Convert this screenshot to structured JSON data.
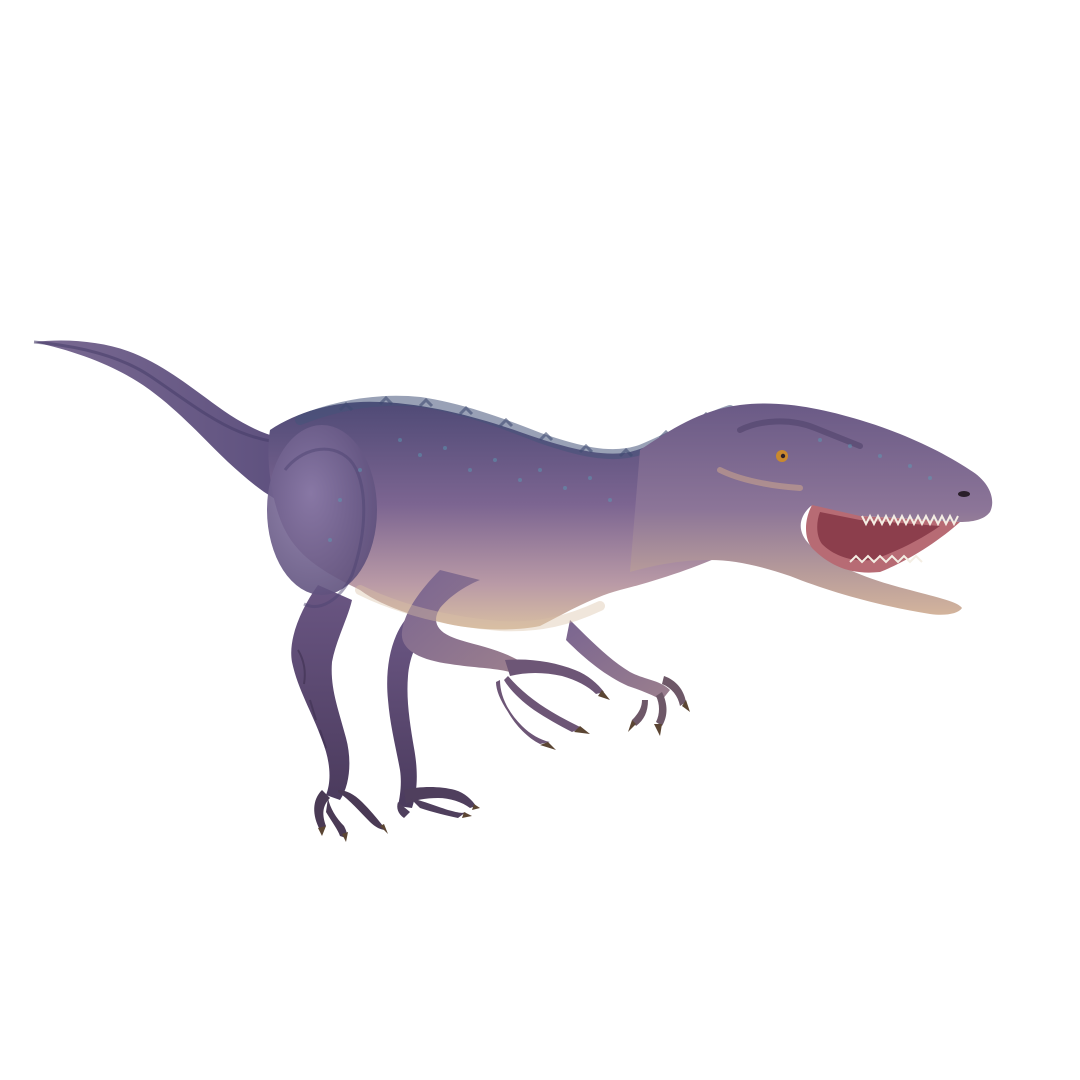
{
  "image": {
    "subject_icon": "dinosaur-illustration",
    "colors": {
      "background": "#ffffff",
      "body_dark": "#5a4a78",
      "body_mid": "#7e6794",
      "body_light": "#a78fb0",
      "belly": "#d2b9a0",
      "dorsal": "#45537a",
      "mouth": "#b76b74",
      "mouth_inner": "#8c3e4c",
      "teeth": "#f4eee4",
      "claws": "#5b4533",
      "eye": "#c9892e"
    }
  }
}
